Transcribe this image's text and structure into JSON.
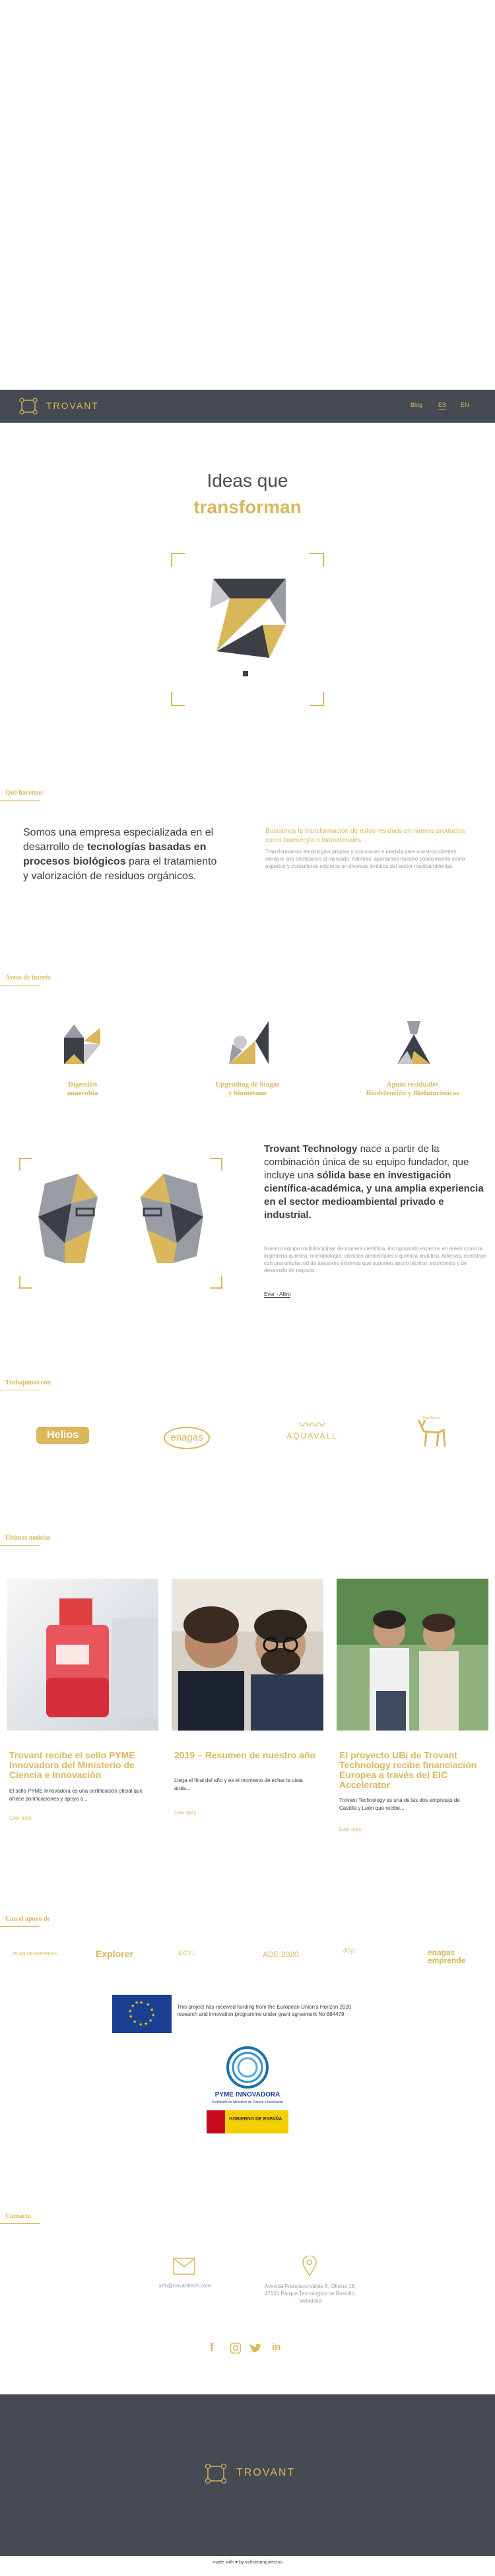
{
  "header": {
    "brand": "TROVANT",
    "nav": [
      "Blog",
      "ES",
      "EN"
    ]
  },
  "hero": {
    "line1": "Ideas que",
    "line2": "transforman"
  },
  "about": {
    "section_title": "Qué hacemos",
    "lead_pre": "Somos una empresa especializada en el desarrollo de ",
    "lead_bold1": "tecnologías basadas en procesos biológicos",
    "lead_post": " para el tratamiento y valorización de residuos orgánicos.",
    "right_title": "Buscamos la transformación de estos residuos en nuevos productos como bioenergía o biomateriales.",
    "right_text": "Transformamos tecnologías propias y soluciones a medida para nuestros clientes, siempre con orientación al mercado. Además, aportamos nuestro conocimiento como expertos y consultores externos en diversos ámbitos del sector medioambiental."
  },
  "areas": {
    "section_title": "Áreas de interés",
    "items": [
      {
        "l1": "Digestión",
        "l2": "anaerobia"
      },
      {
        "l1": "Upgrading de biogas",
        "l2": "y biometano"
      },
      {
        "l1": "Aguas residuales",
        "l2": "Biodefensión y Biofuturísticas"
      }
    ]
  },
  "founders": {
    "title_bold1": "Trovant Technology",
    "title_mid": " nace a partir de la combinación única de su equipo fundador, que incluye una ",
    "title_bold2": "sólida base en investigación científica-académica, y una amplia experiencia en el sector medioambiental privado e industrial.",
    "text": "Nuestro equipo multidisciplinar de manera científica, incorporando expertos en áreas como la ingeniería química, microbiología, ciencias ambientales o química analítica. Además, contamos con una amplia red de asesores externos que suponen apoyo técnico, económico y de desarrollo de negocio.",
    "link": "Ever - Allint"
  },
  "clients": {
    "section_title": "Trabajamos con",
    "logos": [
      "Helios",
      "enagas",
      "AQUAVALL",
      "Gran Ciervo"
    ]
  },
  "news": {
    "section_title": "Últimas noticias",
    "items": [
      {
        "title": "Trovant recibe el sello PYME Innovadora del Ministerio de Ciencia e Innovación",
        "text": "El sello PYME Innovadora es una certificación oficial que ofrece bonificaciones y apoyo a...",
        "more": "Leer más"
      },
      {
        "title": "2019 – Resumen de nuestro año",
        "text": "Llega el final del año y es el momento de echar la vista atrás...",
        "more": "Leer más"
      },
      {
        "title": "El proyecto UBi de Trovant Technology recibe financiación Europea a través del EIC Accelerator",
        "text": "Trovant Technology es una de las dos empresas de Castilla y León que recibe...",
        "more": "Leer más"
      }
    ]
  },
  "support": {
    "section_title": "Con el apoyo de",
    "logos": [
      "PLAN DE EMPRESA",
      "Explorer",
      "ECYL",
      "ADE 2020",
      "JCyL",
      "enagas emprende"
    ],
    "eu_text": "This project has received funding from the European Union's Horizon 2020 research and innovation programme under grant agreement No 884479",
    "pyme_title": "PYME INNOVADORA",
    "pyme_sub": "Certificado de Ministerio de Ciencia e Innovación",
    "gov": "GOBIERNO DE ESPAÑA"
  },
  "contact": {
    "section_title": "Contacto",
    "email": "info@trovanttech.com",
    "address": "Avenida Francisco Vallés 8, Oficina 18, 47151 Parque Tecnológico de Boecillo, Valladolid",
    "social": [
      "f",
      "ig",
      "tw",
      "in"
    ]
  },
  "footer": {
    "brand": "TROVANT",
    "credit": "made with ♥ by indiseoarquitectos"
  },
  "colors": {
    "gold": "#d9b75a",
    "dark": "#464a53"
  }
}
